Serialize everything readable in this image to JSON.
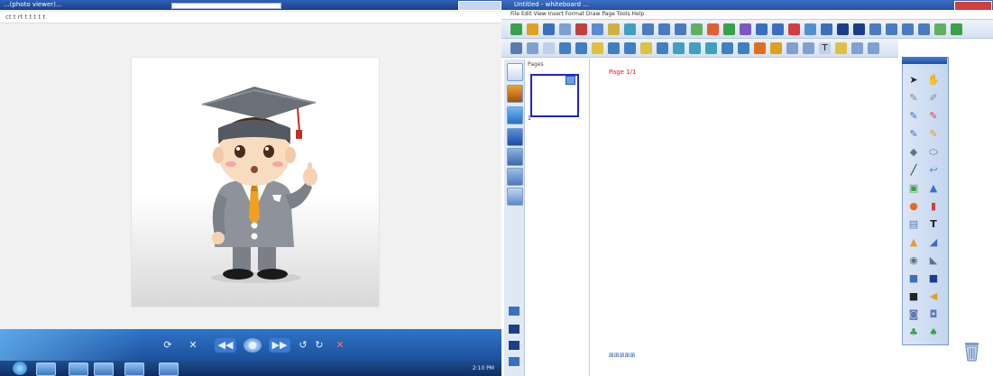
{
  "viewer": {
    "title": "...(photo viewer)...",
    "menu": "ct  t  rt  t  t  t  t   t",
    "player_controls": [
      "⟳",
      "✕",
      "◀◀",
      "●",
      "▶▶",
      "↺",
      "↻",
      "✕"
    ]
  },
  "taskbar": {
    "tray_text": "2:10 PM"
  },
  "board": {
    "title": "Untitled - whiteboard ...",
    "menu": "File  Edit  View  Insert  Format  Draw  Page  Tools  Help",
    "sorter_header": "Pages",
    "thumb_label": "1",
    "page_label": "Page 1/1",
    "bottom_icons": "⊞⊞⊞⊞⊞"
  },
  "palette_tools": [
    "arrow-icon",
    "hand-icon",
    "pen-icon",
    "highlighter-icon",
    "pencil-icon",
    "brush-icon",
    "eraser-icon",
    "line-icon",
    "shape-icon",
    "fill-icon",
    "text-icon",
    "image-icon",
    "camera-icon",
    "chart-icon",
    "screen-icon",
    "record-icon",
    "color-icon",
    "undo-icon",
    "redo-icon",
    "zoom-icon",
    "settings-icon",
    "help-icon",
    "tiq-icon"
  ],
  "colors": {
    "title_bar": "#2d60b8",
    "accent_red": "#e02020",
    "taskbar": "#1b4f9a"
  }
}
